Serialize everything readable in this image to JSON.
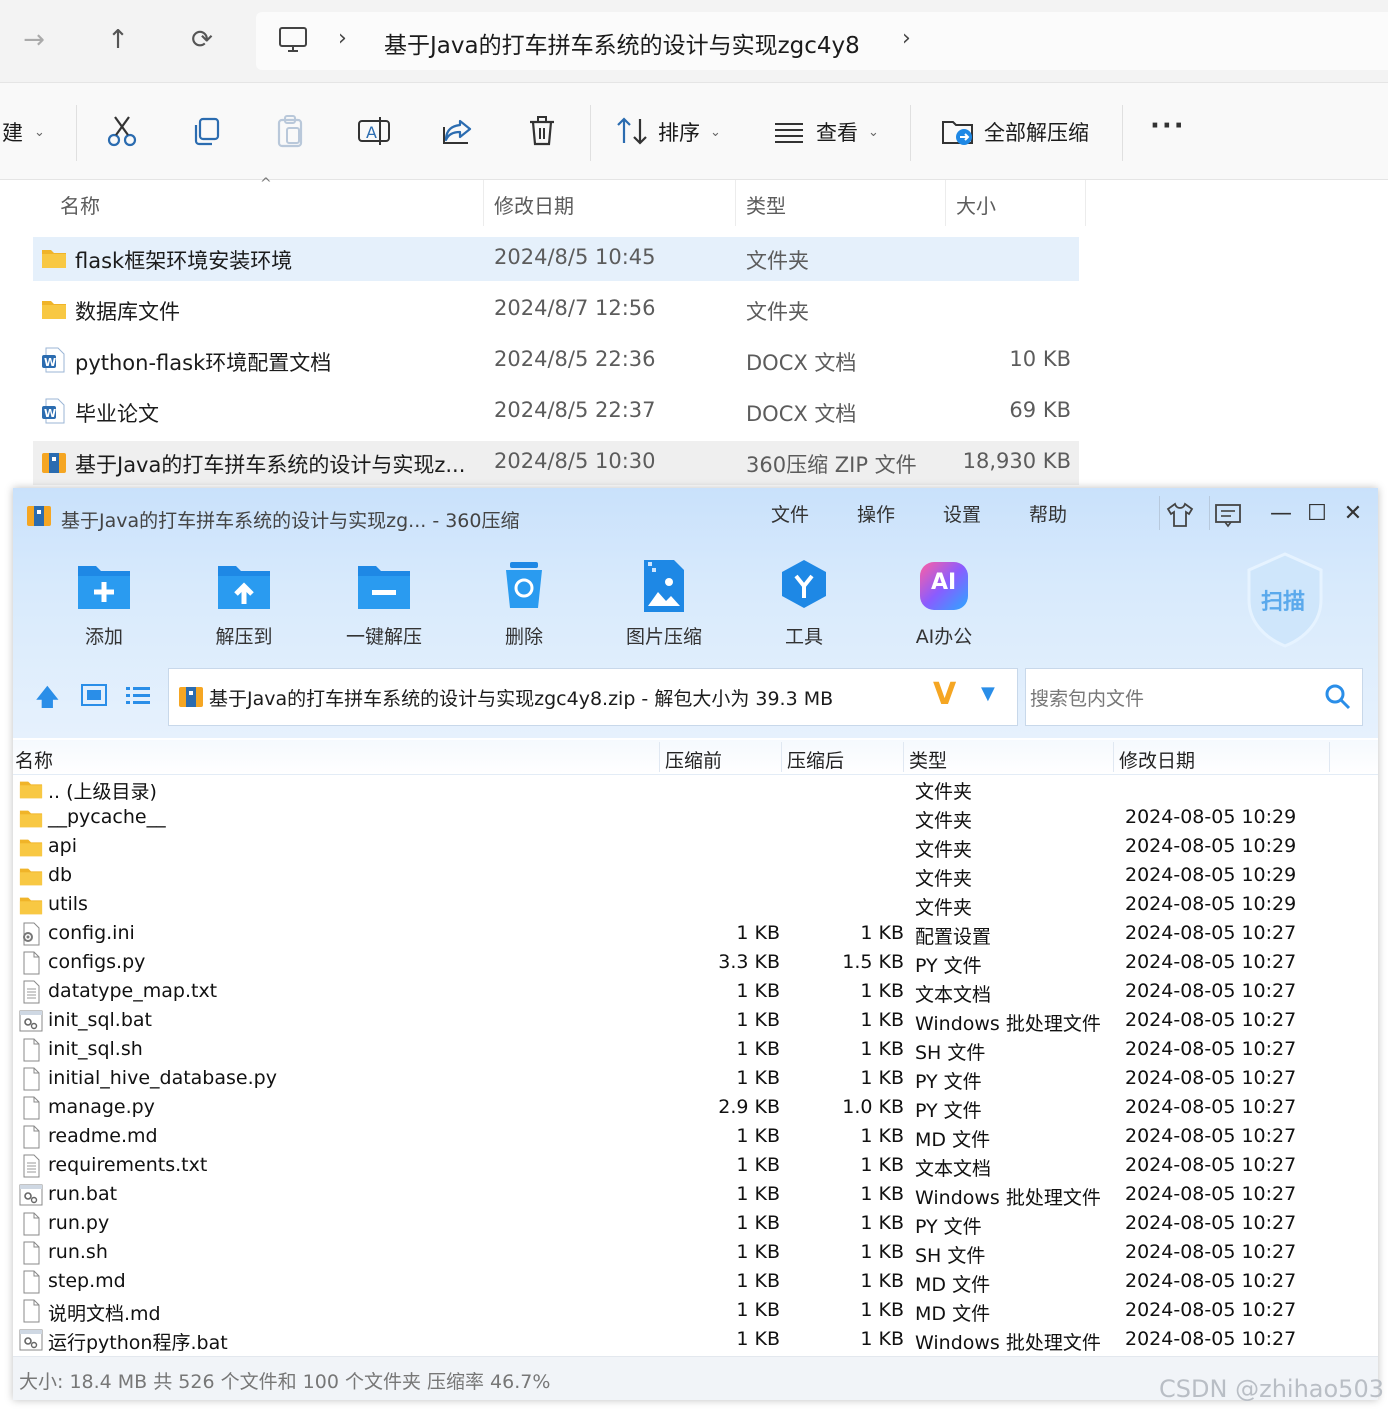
{
  "explorer": {
    "breadcrumb": "基于Java的打车拼车系统的设计与实现zgc4y8",
    "toolbar": {
      "new_label": "建",
      "sort_label": "排序",
      "view_label": "查看",
      "extract_all_label": "全部解压缩"
    },
    "columns": {
      "name": "名称",
      "modified": "修改日期",
      "type": "类型",
      "size": "大小"
    },
    "files": [
      {
        "name": "flask框架环境安装环境",
        "modified": "2024/8/5 10:45",
        "type": "文件夹",
        "size": "",
        "icon": "folder-icon"
      },
      {
        "name": "数据库文件",
        "modified": "2024/8/7 12:56",
        "type": "文件夹",
        "size": "",
        "icon": "folder-icon"
      },
      {
        "name": "python-flask环境配置文档",
        "modified": "2024/8/5 22:36",
        "type": "DOCX 文档",
        "size": "10 KB",
        "icon": "word-doc-icon"
      },
      {
        "name": "毕业论文",
        "modified": "2024/8/5 22:37",
        "type": "DOCX 文档",
        "size": "69 KB",
        "icon": "word-doc-icon"
      },
      {
        "name": "基于Java的打车拼车系统的设计与实现z...",
        "modified": "2024/8/5 10:30",
        "type": "360压缩 ZIP 文件",
        "size": "18,930 KB",
        "icon": "zip-archive-icon"
      }
    ]
  },
  "zip": {
    "title": "基于Java的打车拼车系统的设计与实现zg... - 360压缩",
    "menu": [
      "文件",
      "操作",
      "设置",
      "帮助"
    ],
    "tools": [
      {
        "label": "添加",
        "icon": "add-icon"
      },
      {
        "label": "解压到",
        "icon": "extract-to-icon"
      },
      {
        "label": "一键解压",
        "icon": "one-click-extract-icon"
      },
      {
        "label": "删除",
        "icon": "delete-icon"
      },
      {
        "label": "图片压缩",
        "icon": "image-compress-icon"
      },
      {
        "label": "工具",
        "icon": "tools-icon"
      },
      {
        "label": "AI办公",
        "icon": "ai-office-icon"
      }
    ],
    "scan_label": "扫描",
    "ai_badge": "AI",
    "path": "基于Java的打车拼车系统的设计与实现zgc4y8.zip - 解包大小为 39.3 MB",
    "search_placeholder": "搜索包内文件",
    "columns": {
      "name": "名称",
      "before": "压缩前",
      "after": "压缩后",
      "type": "类型",
      "modified": "修改日期"
    },
    "rows": [
      {
        "name": ".. (上级目录)",
        "before": "",
        "after": "",
        "type": "文件夹",
        "modified": "",
        "icon": "folder-icon"
      },
      {
        "name": "__pycache__",
        "before": "",
        "after": "",
        "type": "文件夹",
        "modified": "2024-08-05 10:29",
        "icon": "folder-icon"
      },
      {
        "name": "api",
        "before": "",
        "after": "",
        "type": "文件夹",
        "modified": "2024-08-05 10:29",
        "icon": "folder-icon"
      },
      {
        "name": "db",
        "before": "",
        "after": "",
        "type": "文件夹",
        "modified": "2024-08-05 10:29",
        "icon": "folder-icon"
      },
      {
        "name": "utils",
        "before": "",
        "after": "",
        "type": "文件夹",
        "modified": "2024-08-05 10:29",
        "icon": "folder-icon"
      },
      {
        "name": "config.ini",
        "before": "1 KB",
        "after": "1 KB",
        "type": "配置设置",
        "modified": "2024-08-05 10:27",
        "icon": "settings-file-icon"
      },
      {
        "name": "configs.py",
        "before": "3.3 KB",
        "after": "1.5 KB",
        "type": "PY 文件",
        "modified": "2024-08-05 10:27",
        "icon": "file-icon"
      },
      {
        "name": "datatype_map.txt",
        "before": "1 KB",
        "after": "1 KB",
        "type": "文本文档",
        "modified": "2024-08-05 10:27",
        "icon": "text-file-icon"
      },
      {
        "name": "init_sql.bat",
        "before": "1 KB",
        "after": "1 KB",
        "type": "Windows 批处理文件",
        "modified": "2024-08-05 10:27",
        "icon": "batch-file-icon"
      },
      {
        "name": "init_sql.sh",
        "before": "1 KB",
        "after": "1 KB",
        "type": "SH 文件",
        "modified": "2024-08-05 10:27",
        "icon": "file-icon"
      },
      {
        "name": "initial_hive_database.py",
        "before": "1 KB",
        "after": "1 KB",
        "type": "PY 文件",
        "modified": "2024-08-05 10:27",
        "icon": "file-icon"
      },
      {
        "name": "manage.py",
        "before": "2.9 KB",
        "after": "1.0 KB",
        "type": "PY 文件",
        "modified": "2024-08-05 10:27",
        "icon": "file-icon"
      },
      {
        "name": "readme.md",
        "before": "1 KB",
        "after": "1 KB",
        "type": "MD 文件",
        "modified": "2024-08-05 10:27",
        "icon": "file-icon"
      },
      {
        "name": "requirements.txt",
        "before": "1 KB",
        "after": "1 KB",
        "type": "文本文档",
        "modified": "2024-08-05 10:27",
        "icon": "text-file-icon"
      },
      {
        "name": "run.bat",
        "before": "1 KB",
        "after": "1 KB",
        "type": "Windows 批处理文件",
        "modified": "2024-08-05 10:27",
        "icon": "batch-file-icon"
      },
      {
        "name": "run.py",
        "before": "1 KB",
        "after": "1 KB",
        "type": "PY 文件",
        "modified": "2024-08-05 10:27",
        "icon": "file-icon"
      },
      {
        "name": "run.sh",
        "before": "1 KB",
        "after": "1 KB",
        "type": "SH 文件",
        "modified": "2024-08-05 10:27",
        "icon": "file-icon"
      },
      {
        "name": "step.md",
        "before": "1 KB",
        "after": "1 KB",
        "type": "MD 文件",
        "modified": "2024-08-05 10:27",
        "icon": "file-icon"
      },
      {
        "name": "说明文档.md",
        "before": "1 KB",
        "after": "1 KB",
        "type": "MD 文件",
        "modified": "2024-08-05 10:27",
        "icon": "file-icon"
      },
      {
        "name": "运行python程序.bat",
        "before": "1 KB",
        "after": "1 KB",
        "type": "Windows 批处理文件",
        "modified": "2024-08-05 10:27",
        "icon": "batch-file-icon"
      }
    ],
    "status": "大小: 18.4 MB 共 526 个文件和 100 个文件夹 压缩率 46.7%"
  },
  "watermark": "CSDN @zhihao503",
  "colors": {
    "selection": "#e5f0fb",
    "zip_header": "#c9e1fb",
    "accent_blue": "#1e88e5",
    "folder_yellow": "#f8c843"
  }
}
